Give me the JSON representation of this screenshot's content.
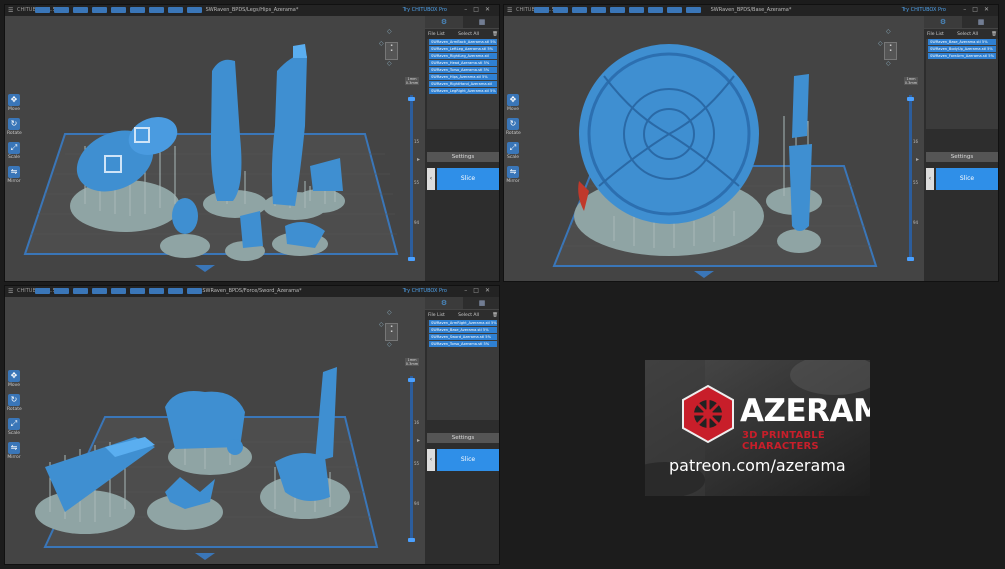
{
  "colors": {
    "accent": "#2f8fe8",
    "model_blue": "#3f8fd1",
    "support_gray": "#8fa4a4",
    "plate_blue": "#3a76b8",
    "brand_red": "#c81e2a"
  },
  "windows": [
    {
      "app_name": "CHITUBOX V1.5.0",
      "filename": "SWRaven_BPDS/Legs/Hips_Azerama*",
      "try_pro": "Try CHITUBOX Pro",
      "sidebar": {
        "select_all": "Select All",
        "file_list_label": "File List",
        "files": [
          "SWRaven_ArmBack_Azerama.stl 5%",
          "SWRaven_LeftLeg_Azerama.stl 5%",
          "SWRaven_RightLeg_Azerama.stl",
          "SWRaven_Head_Azerama.stl 5%",
          "SWRaven_Torso_Azerama.stl 5%",
          "SWRaven_Hips_Azerama.stl 5%",
          "SWRaven_RightHand_Azerama.stl",
          "SWRaven_LegRight_Azerama.stl 5%"
        ],
        "settings_label": "Settings",
        "slice_label": "Slice"
      },
      "tools": [
        {
          "icon": "move-icon",
          "label": "Move"
        },
        {
          "icon": "rotate-icon",
          "label": "Rotate"
        },
        {
          "icon": "scale-icon",
          "label": "Scale"
        },
        {
          "icon": "mirror-icon",
          "label": "Mirror"
        }
      ],
      "layers": {
        "top_label": "1mm",
        "unit": "0.3mm",
        "marks": [
          "15",
          "55",
          "94"
        ]
      }
    },
    {
      "app_name": "CHITUBOX V1.5.0",
      "filename": "SWRaven_BPDS/Base_Azerama*",
      "try_pro": "Try CHITUBOX Pro",
      "sidebar": {
        "select_all": "Select All",
        "file_list_label": "File List",
        "files": [
          "SWRaven_Base_Azerama.stl 5%",
          "SWRaven_BodyUp_Azerama.stl 5%",
          "SWRaven_ForeArm_Azerama.stl 5%"
        ],
        "settings_label": "Settings",
        "slice_label": "Slice"
      },
      "tools": [
        {
          "icon": "move-icon",
          "label": "Move"
        },
        {
          "icon": "rotate-icon",
          "label": "Rotate"
        },
        {
          "icon": "scale-icon",
          "label": "Scale"
        },
        {
          "icon": "mirror-icon",
          "label": "Mirror"
        }
      ],
      "layers": {
        "top_label": "1mm",
        "unit": "0.3mm",
        "marks": [
          "16",
          "55",
          "94"
        ]
      }
    },
    {
      "app_name": "CHITUBOX V1.5.0",
      "filename": "SWRaven_BPDS/Force/Sword_Azerama*",
      "try_pro": "Try CHITUBOX Pro",
      "sidebar": {
        "select_all": "Select All",
        "file_list_label": "File List",
        "files": [
          "SWRaven_ArmRight_Azerama.stl 5%",
          "SWRaven_Base_Azerama.stl 5%",
          "SWRaven_Sword_Azerama.stl 5%",
          "SWRaven_Torso_Azerama.stl 5%"
        ],
        "settings_label": "Settings",
        "slice_label": "Slice"
      },
      "tools": [
        {
          "icon": "move-icon",
          "label": "Move"
        },
        {
          "icon": "rotate-icon",
          "label": "Rotate"
        },
        {
          "icon": "scale-icon",
          "label": "Scale"
        },
        {
          "icon": "mirror-icon",
          "label": "Mirror"
        }
      ],
      "layers": {
        "top_label": "1mm",
        "unit": "0.3mm",
        "marks": [
          "16",
          "55",
          "94"
        ]
      }
    }
  ],
  "ad": {
    "brand": "AZERAMA",
    "tagline": "3D PRINTABLE CHARACTERS",
    "url": "patreon.com/azerama"
  }
}
